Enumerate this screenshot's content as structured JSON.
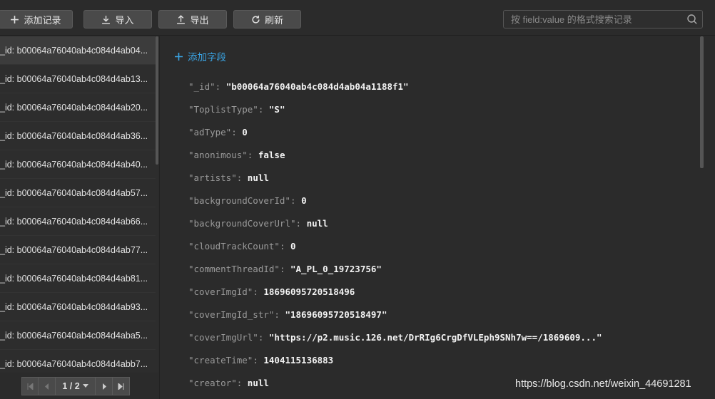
{
  "toolbar": {
    "add_label": "添加记录",
    "import_label": "导入",
    "export_label": "导出",
    "refresh_label": "刷新",
    "search_placeholder": "按 field:value 的格式搜索记录"
  },
  "records": [
    "_id: b00064a76040ab4c084d4ab04...",
    "_id: b00064a76040ab4c084d4ab13...",
    "_id: b00064a76040ab4c084d4ab20...",
    "_id: b00064a76040ab4c084d4ab36...",
    "_id: b00064a76040ab4c084d4ab40...",
    "_id: b00064a76040ab4c084d4ab57...",
    "_id: b00064a76040ab4c084d4ab66...",
    "_id: b00064a76040ab4c084d4ab77...",
    "_id: b00064a76040ab4c084d4ab81...",
    "_id: b00064a76040ab4c084d4ab93...",
    "_id: b00064a76040ab4c084d4aba5...",
    "_id: b00064a76040ab4c084d4abb7..."
  ],
  "pager": {
    "page": "1 / 2"
  },
  "detail": {
    "add_field_label": "添加字段",
    "fields": [
      {
        "key": "\"_id\"",
        "value": "\"b00064a76040ab4c084d4ab04a1188f1\""
      },
      {
        "key": "\"ToplistType\"",
        "value": "\"S\""
      },
      {
        "key": "\"adType\"",
        "value": "0"
      },
      {
        "key": "\"anonimous\"",
        "value": "false"
      },
      {
        "key": "\"artists\"",
        "value": "null"
      },
      {
        "key": "\"backgroundCoverId\"",
        "value": "0"
      },
      {
        "key": "\"backgroundCoverUrl\"",
        "value": "null"
      },
      {
        "key": "\"cloudTrackCount\"",
        "value": "0"
      },
      {
        "key": "\"commentThreadId\"",
        "value": "\"A_PL_0_19723756\""
      },
      {
        "key": "\"coverImgId\"",
        "value": "18696095720518496"
      },
      {
        "key": "\"coverImgId_str\"",
        "value": "\"18696095720518497\""
      },
      {
        "key": "\"coverImgUrl\"",
        "value": "\"https://p2.music.126.net/DrRIg6CrgDfVLEph9SNh7w==/1869609...\""
      },
      {
        "key": "\"createTime\"",
        "value": "1404115136883"
      },
      {
        "key": "\"creator\"",
        "value": "null"
      }
    ]
  },
  "watermark": "https://blog.csdn.net/weixin_44691281",
  "colors": {
    "accent": "#3aa3e3",
    "background": "#2b2b2b"
  }
}
